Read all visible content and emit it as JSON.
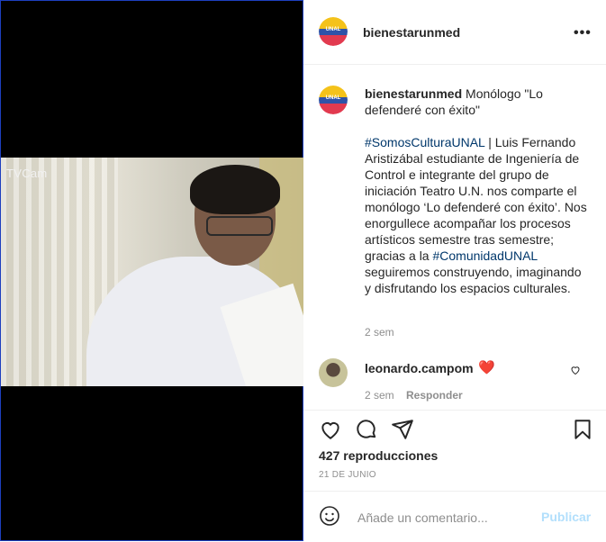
{
  "post": {
    "username": "bienestarunmed",
    "avatar_text": "UNAL",
    "more_icon": "more-horizontal-icon",
    "video_watermark": "TVCam"
  },
  "caption": {
    "username": "bienestarunmed",
    "title": " Monólogo \"Lo defenderé con éxito\"",
    "hashtag1": "#SomosCulturaUNAL",
    "body1": " | Luis Fernando Aristizábal estudiante de Ingeniería de Control e integrante del grupo de iniciación Teatro U.N. nos comparte el monólogo ‘Lo defenderé con éxito’. Nos enorgullece acompañar los procesos artísticos semestre tras semestre; gracias a la ",
    "hashtag2": "#ComunidadUNAL",
    "body2": " seguiremos construyendo, imaginando y disfrutando los espacios culturales.",
    "time": "2 sem"
  },
  "comment": {
    "username": "leonardo.campom",
    "emoji": "❤️",
    "time": "2 sem",
    "reply_label": "Responder"
  },
  "stats": {
    "views": "427 reproducciones",
    "date": "21 DE JUNIO"
  },
  "composer": {
    "placeholder": "Añade un comentario...",
    "publish_label": "Publicar"
  },
  "colors": {
    "link": "#00376b",
    "publish_disabled": "#b2dffc",
    "muted": "#8e8e8e"
  }
}
